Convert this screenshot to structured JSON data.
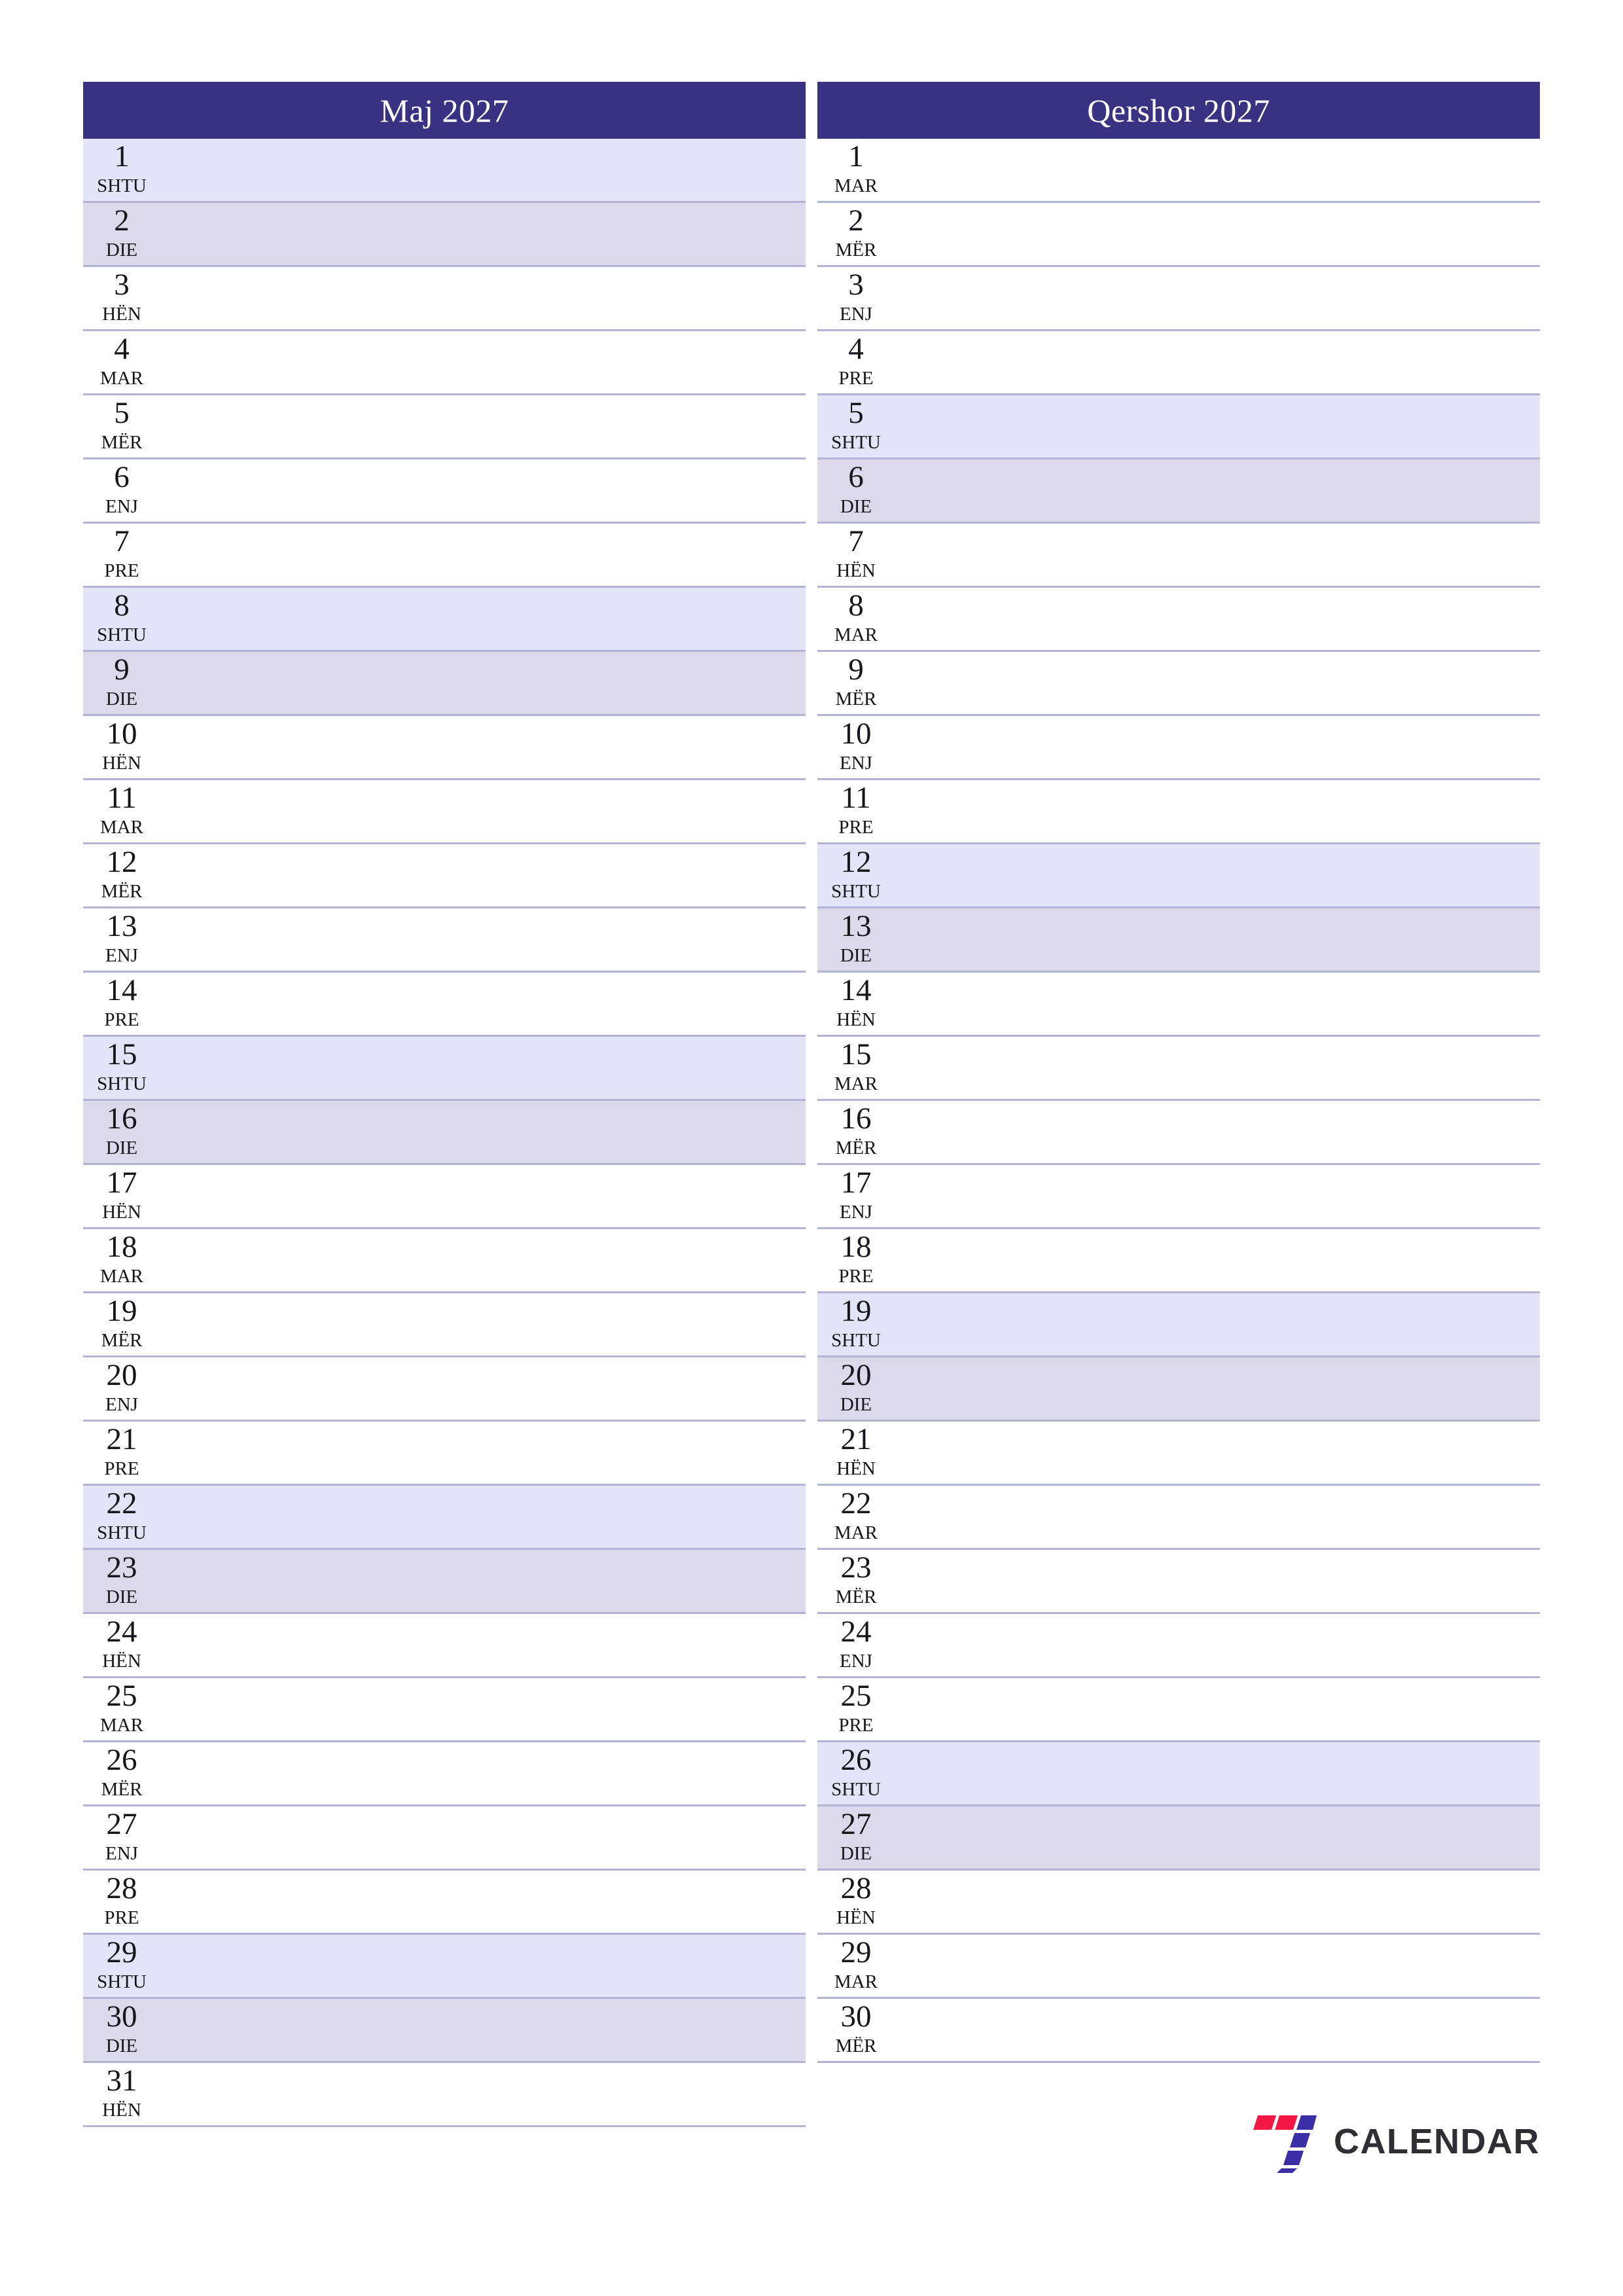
{
  "page": {
    "title": "Maj 2027 / Qershor 2027 planner",
    "accent_color": "#393283",
    "saturday_color": "#e3e4f7",
    "sunday_color": "#dbd9ea",
    "rule_color": "#b3b2d4"
  },
  "weekday_names": {
    "saturday": "SHTU",
    "sunday": "DIE",
    "monday": "HËN",
    "tuesday": "MAR",
    "wednesday": "MËR",
    "thursday": "ENJ",
    "friday": "PRE"
  },
  "months": [
    {
      "title": "Maj 2027",
      "days": [
        {
          "num": "1",
          "wd": "SHTU",
          "type": "sat"
        },
        {
          "num": "2",
          "wd": "DIE",
          "type": "sun"
        },
        {
          "num": "3",
          "wd": "HËN",
          "type": "wd"
        },
        {
          "num": "4",
          "wd": "MAR",
          "type": "wd"
        },
        {
          "num": "5",
          "wd": "MËR",
          "type": "wd"
        },
        {
          "num": "6",
          "wd": "ENJ",
          "type": "wd"
        },
        {
          "num": "7",
          "wd": "PRE",
          "type": "wd"
        },
        {
          "num": "8",
          "wd": "SHTU",
          "type": "sat"
        },
        {
          "num": "9",
          "wd": "DIE",
          "type": "sun"
        },
        {
          "num": "10",
          "wd": "HËN",
          "type": "wd"
        },
        {
          "num": "11",
          "wd": "MAR",
          "type": "wd"
        },
        {
          "num": "12",
          "wd": "MËR",
          "type": "wd"
        },
        {
          "num": "13",
          "wd": "ENJ",
          "type": "wd"
        },
        {
          "num": "14",
          "wd": "PRE",
          "type": "wd"
        },
        {
          "num": "15",
          "wd": "SHTU",
          "type": "sat"
        },
        {
          "num": "16",
          "wd": "DIE",
          "type": "sun"
        },
        {
          "num": "17",
          "wd": "HËN",
          "type": "wd"
        },
        {
          "num": "18",
          "wd": "MAR",
          "type": "wd"
        },
        {
          "num": "19",
          "wd": "MËR",
          "type": "wd"
        },
        {
          "num": "20",
          "wd": "ENJ",
          "type": "wd"
        },
        {
          "num": "21",
          "wd": "PRE",
          "type": "wd"
        },
        {
          "num": "22",
          "wd": "SHTU",
          "type": "sat"
        },
        {
          "num": "23",
          "wd": "DIE",
          "type": "sun"
        },
        {
          "num": "24",
          "wd": "HËN",
          "type": "wd"
        },
        {
          "num": "25",
          "wd": "MAR",
          "type": "wd"
        },
        {
          "num": "26",
          "wd": "MËR",
          "type": "wd"
        },
        {
          "num": "27",
          "wd": "ENJ",
          "type": "wd"
        },
        {
          "num": "28",
          "wd": "PRE",
          "type": "wd"
        },
        {
          "num": "29",
          "wd": "SHTU",
          "type": "sat"
        },
        {
          "num": "30",
          "wd": "DIE",
          "type": "sun"
        },
        {
          "num": "31",
          "wd": "HËN",
          "type": "wd"
        }
      ]
    },
    {
      "title": "Qershor 2027",
      "days": [
        {
          "num": "1",
          "wd": "MAR",
          "type": "wd"
        },
        {
          "num": "2",
          "wd": "MËR",
          "type": "wd"
        },
        {
          "num": "3",
          "wd": "ENJ",
          "type": "wd"
        },
        {
          "num": "4",
          "wd": "PRE",
          "type": "wd"
        },
        {
          "num": "5",
          "wd": "SHTU",
          "type": "sat"
        },
        {
          "num": "6",
          "wd": "DIE",
          "type": "sun"
        },
        {
          "num": "7",
          "wd": "HËN",
          "type": "wd"
        },
        {
          "num": "8",
          "wd": "MAR",
          "type": "wd"
        },
        {
          "num": "9",
          "wd": "MËR",
          "type": "wd"
        },
        {
          "num": "10",
          "wd": "ENJ",
          "type": "wd"
        },
        {
          "num": "11",
          "wd": "PRE",
          "type": "wd"
        },
        {
          "num": "12",
          "wd": "SHTU",
          "type": "sat"
        },
        {
          "num": "13",
          "wd": "DIE",
          "type": "sun"
        },
        {
          "num": "14",
          "wd": "HËN",
          "type": "wd"
        },
        {
          "num": "15",
          "wd": "MAR",
          "type": "wd"
        },
        {
          "num": "16",
          "wd": "MËR",
          "type": "wd"
        },
        {
          "num": "17",
          "wd": "ENJ",
          "type": "wd"
        },
        {
          "num": "18",
          "wd": "PRE",
          "type": "wd"
        },
        {
          "num": "19",
          "wd": "SHTU",
          "type": "sat"
        },
        {
          "num": "20",
          "wd": "DIE",
          "type": "sun"
        },
        {
          "num": "21",
          "wd": "HËN",
          "type": "wd"
        },
        {
          "num": "22",
          "wd": "MAR",
          "type": "wd"
        },
        {
          "num": "23",
          "wd": "MËR",
          "type": "wd"
        },
        {
          "num": "24",
          "wd": "ENJ",
          "type": "wd"
        },
        {
          "num": "25",
          "wd": "PRE",
          "type": "wd"
        },
        {
          "num": "26",
          "wd": "SHTU",
          "type": "sat"
        },
        {
          "num": "27",
          "wd": "DIE",
          "type": "sun"
        },
        {
          "num": "28",
          "wd": "HËN",
          "type": "wd"
        },
        {
          "num": "29",
          "wd": "MAR",
          "type": "wd"
        },
        {
          "num": "30",
          "wd": "MËR",
          "type": "wd"
        }
      ]
    }
  ],
  "logo": {
    "icon": "seven-calendar-logo-icon",
    "text": "CALENDAR",
    "red": "#f31746",
    "blue": "#3b2fa8",
    "text_color": "#2e2e33"
  }
}
